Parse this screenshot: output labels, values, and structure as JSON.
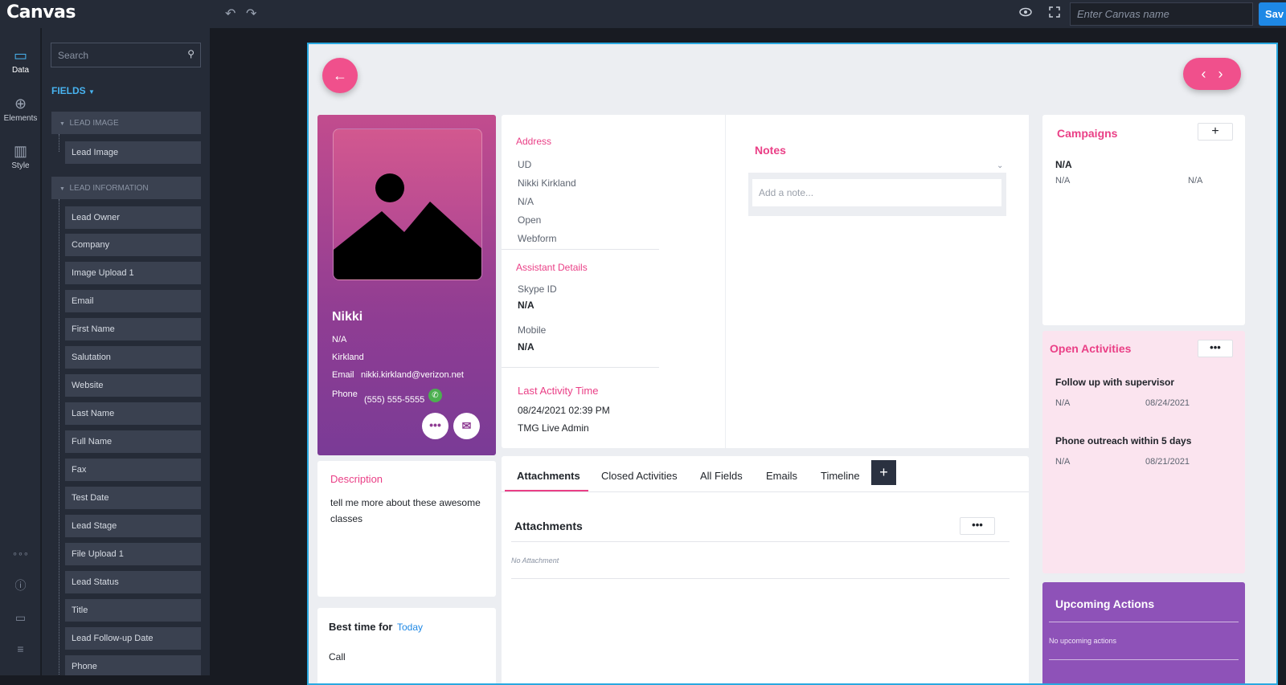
{
  "app": {
    "logo": "Canvas"
  },
  "topbar": {
    "undo_icon": "undo-icon",
    "redo_icon": "redo-icon",
    "preview_icon": "eye-icon",
    "fullscreen_icon": "fullscreen-icon",
    "canvas_name_placeholder": "Enter Canvas name",
    "save_label": "Sav"
  },
  "rail": {
    "items": [
      {
        "label": "Data",
        "icon": "data-icon"
      },
      {
        "label": "Elements",
        "icon": "plus-circle-icon"
      },
      {
        "label": "Style",
        "icon": "style-icon"
      }
    ]
  },
  "panel": {
    "search_placeholder": "Search",
    "fields_label": "FIELDS",
    "groups": [
      {
        "label": "LEAD IMAGE",
        "items": [
          "Lead Image"
        ]
      },
      {
        "label": "LEAD INFORMATION",
        "items": [
          "Lead Owner",
          "Company",
          "Image Upload 1",
          "Email",
          "First Name",
          "Salutation",
          "Website",
          "Last Name",
          "Full Name",
          "Fax",
          "Test Date",
          "Lead Stage",
          "File Upload 1",
          "Lead Status",
          "Title",
          "Lead Follow-up Date",
          "Phone"
        ]
      }
    ]
  },
  "profile": {
    "name": "Nikki",
    "line1": "N/A",
    "line2": "Kirkland",
    "email_label": "Email",
    "email": "nikki.kirkland@verizon.net",
    "phone_label": "Phone",
    "phone": "(555) 555-5555"
  },
  "description": {
    "title": "Description",
    "text": "tell me more about these awesome classes"
  },
  "best_time": {
    "title": "Best time for",
    "link": "Today",
    "value": "Call"
  },
  "address": {
    "title": "Address",
    "lines": [
      "UD",
      "Nikki Kirkland",
      "N/A",
      "Open",
      "Webform"
    ]
  },
  "assistant": {
    "title": "Assistant Details",
    "skype_label": "Skype ID",
    "skype_value": "N/A",
    "mobile_label": "Mobile",
    "mobile_value": "N/A"
  },
  "last_activity": {
    "title": "Last Activity Time",
    "time": "08/24/2021 02:39 PM",
    "by": "TMG Live Admin"
  },
  "notes": {
    "title": "Notes",
    "placeholder": "Add a note..."
  },
  "tabs": {
    "items": [
      "Attachments",
      "Closed Activities",
      "All Fields",
      "Emails",
      "Timeline"
    ],
    "active": "Attachments",
    "add": "+"
  },
  "attachments": {
    "title": "Attachments",
    "empty": "No Attachment"
  },
  "campaigns": {
    "title": "Campaigns",
    "add": "+",
    "heading": "N/A",
    "col1": "N/A",
    "col2": "N/A"
  },
  "open_activities": {
    "title": "Open Activities",
    "items": [
      {
        "title": "Follow up with supervisor",
        "status": "N/A",
        "date": "08/24/2021"
      },
      {
        "title": "Phone outreach within 5 days",
        "status": "N/A",
        "date": "08/21/2021"
      }
    ]
  },
  "upcoming": {
    "title": "Upcoming Actions",
    "empty": "No upcoming actions"
  },
  "colors": {
    "accent": "#f0508c",
    "pink_text": "#ea3f86",
    "purple": "#8f3d93",
    "topbar": "#252b37",
    "frame_border": "#29a8e0"
  }
}
